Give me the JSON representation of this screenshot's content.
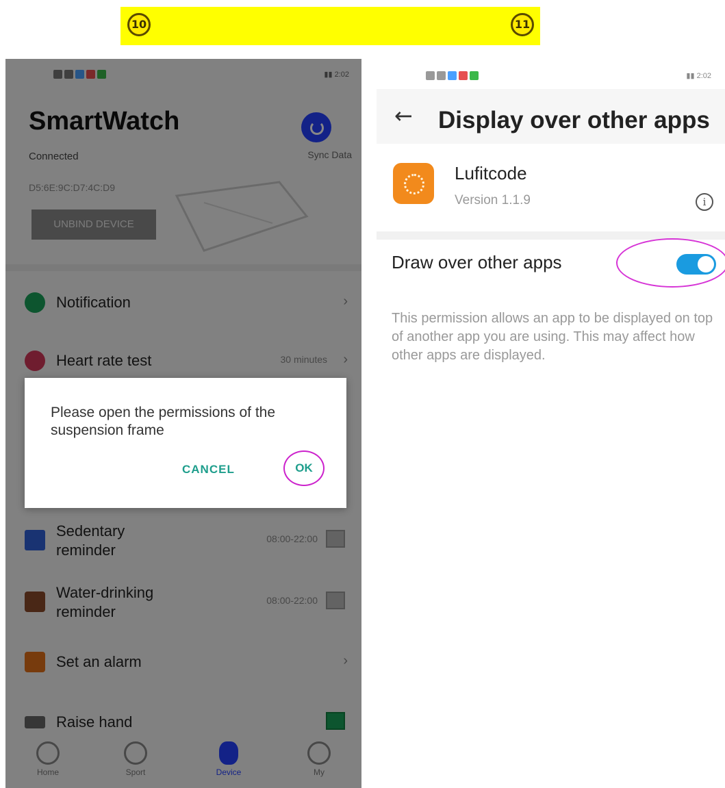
{
  "steps": {
    "left": "10",
    "right": "11"
  },
  "colors": {
    "banner": "#ffff00",
    "accent_teal": "#1e9e8c",
    "toggle_on": "#1a9be0",
    "highlight_ring": "#d633d6",
    "device_blue": "#2540ff"
  },
  "left_screen": {
    "status_time": "2:02",
    "title": "SmartWatch",
    "connection": "Connected",
    "mac_address": "D5:6E:9C:D7:4C:D9",
    "unbind_button": "UNBIND DEVICE",
    "sync_button": "Sync Data",
    "menu": [
      {
        "label": "Notification",
        "icon": "heart-chat-icon",
        "value": ""
      },
      {
        "label": "Heart rate test",
        "icon": "heart-icon",
        "value": "30 minutes"
      },
      {
        "label": "Sedentary reminder",
        "icon": "chart-icon",
        "value": "08:00-22:00"
      },
      {
        "label": "Water-drinking reminder",
        "icon": "cup-icon",
        "value": "08:00-22:00"
      },
      {
        "label": "Set an alarm",
        "icon": "alarm-icon",
        "value": ""
      },
      {
        "label": "Raise hand",
        "icon": "hand-icon",
        "value": ""
      }
    ],
    "nav": [
      {
        "label": "Home",
        "icon": "home-icon"
      },
      {
        "label": "Sport",
        "icon": "sport-icon"
      },
      {
        "label": "Device",
        "icon": "watch-icon"
      },
      {
        "label": "My",
        "icon": "person-icon"
      }
    ],
    "dialog": {
      "message": "Please open the permissions of the suspension frame",
      "cancel": "CANCEL",
      "ok": "OK"
    }
  },
  "right_screen": {
    "status_time": "2:02",
    "title": "Display over other apps",
    "app_name": "Lufitcode",
    "app_version": "Version 1.1.9",
    "setting_label": "Draw over other apps",
    "setting_enabled": true,
    "description": "This permission allows an app to be displayed on top of another app you are using. This may affect how other apps are displayed."
  }
}
